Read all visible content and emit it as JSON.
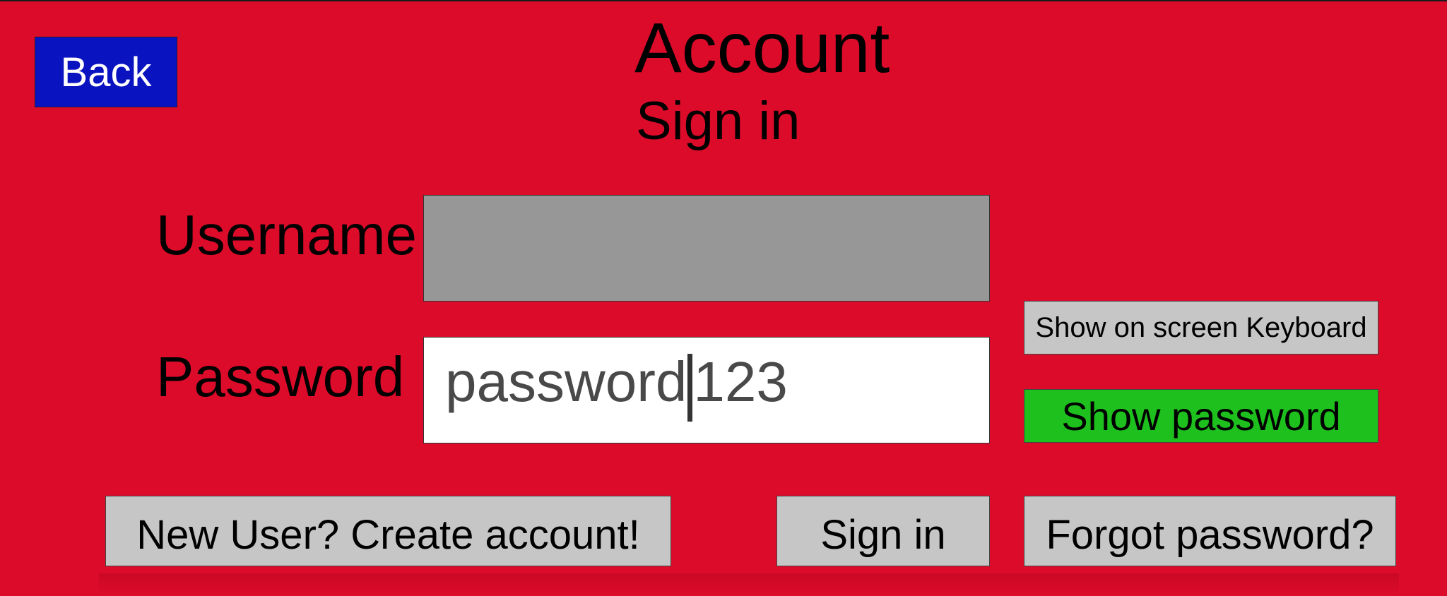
{
  "header": {
    "back_label": "Back",
    "title": "Account",
    "subtitle": "Sign in"
  },
  "form": {
    "username_label": "Username",
    "username_value": "",
    "password_label": "Password",
    "password_value_before_caret": "password",
    "password_value_after_caret": "123"
  },
  "side_buttons": {
    "keyboard_label": "Show on screen Keyboard",
    "show_password_label": "Show password"
  },
  "footer": {
    "new_user_label": "New User? Create account!",
    "sign_in_label": "Sign in",
    "forgot_label": "Forgot password?"
  },
  "colors": {
    "background": "#dc0b2a",
    "back_button": "#0a13c0",
    "show_password_button": "#1ec01e",
    "neutral_button": "#c6c6c6",
    "username_field": "#979797"
  }
}
